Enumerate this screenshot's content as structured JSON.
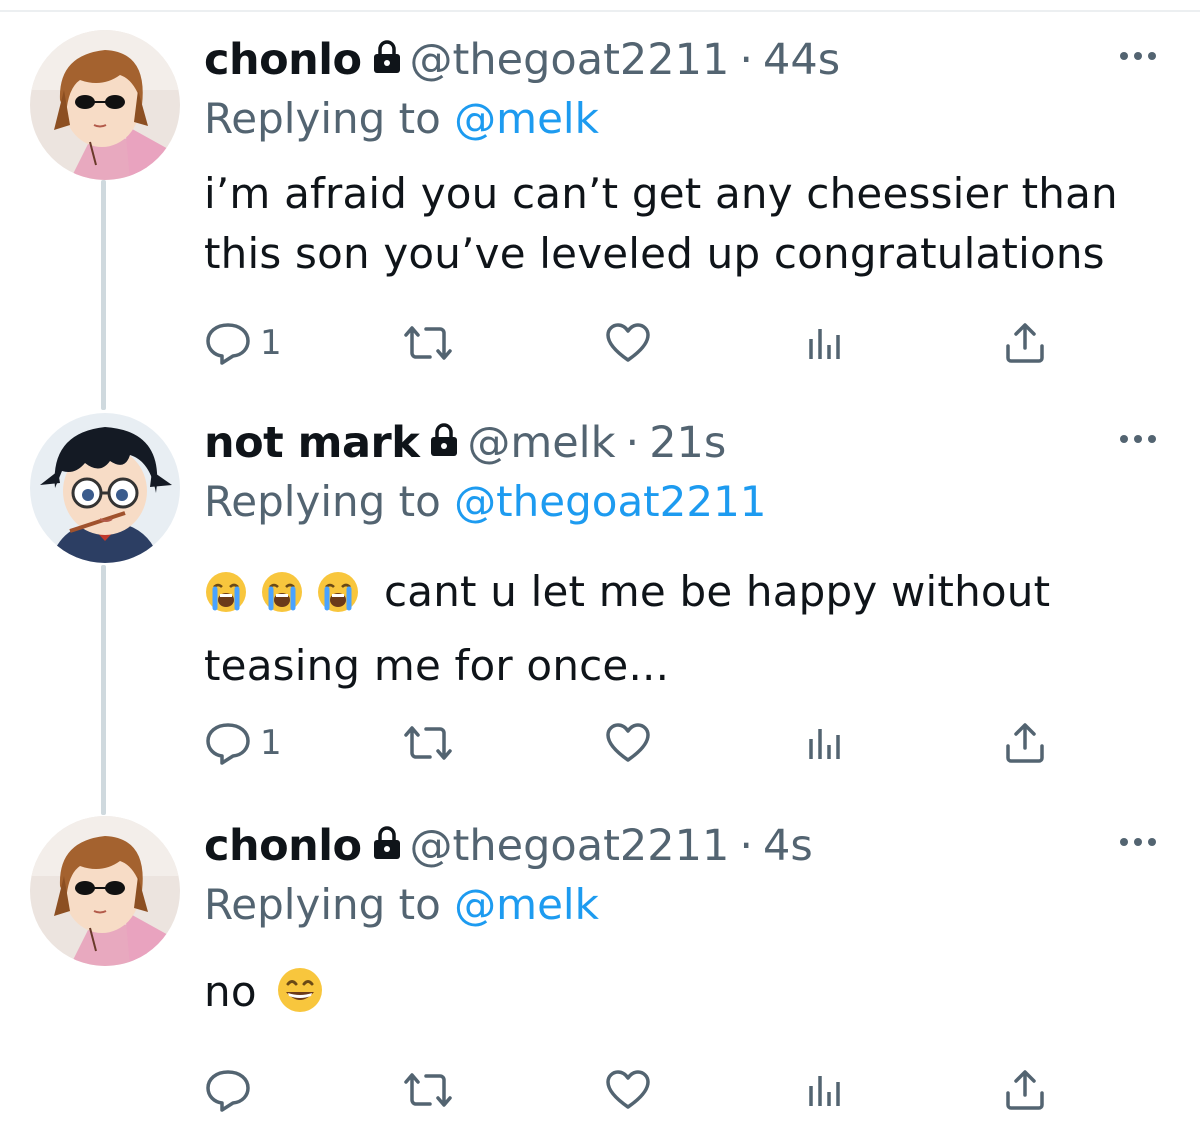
{
  "tweets": [
    {
      "name": "chonlo",
      "handle": "@thegoat2211",
      "time": "44s",
      "replying_prefix": "Replying to",
      "replying_to": "@melk",
      "text_lines": [
        "i’m afraid you can’t get any cheessier than",
        "this son you’ve leveled up congratulations"
      ],
      "reply_count": "1",
      "avatar": "anime-girl-sunglasses"
    },
    {
      "name": "not mark",
      "handle": "@melk",
      "time": "21s",
      "replying_prefix": "Replying to",
      "replying_to": "@thegoat2211",
      "text_lines": [
        "cant u let me be happy without",
        "teasing me for once..."
      ],
      "emojis": [
        "loudly-crying-face",
        "loudly-crying-face",
        "loudly-crying-face"
      ],
      "reply_count": "1",
      "avatar": "anime-boy-glasses"
    },
    {
      "name": "chonlo",
      "handle": "@thegoat2211",
      "time": "4s",
      "replying_prefix": "Replying to",
      "replying_to": "@melk",
      "text_lines": [
        "no"
      ],
      "emojis": [
        "grinning-face"
      ],
      "reply_count": "",
      "avatar": "anime-girl-sunglasses"
    }
  ],
  "separator": "·",
  "colors": {
    "text": "#0f1419",
    "secondary": "#536471",
    "link": "#1d9bf0",
    "thread_line": "#cfd9de"
  }
}
